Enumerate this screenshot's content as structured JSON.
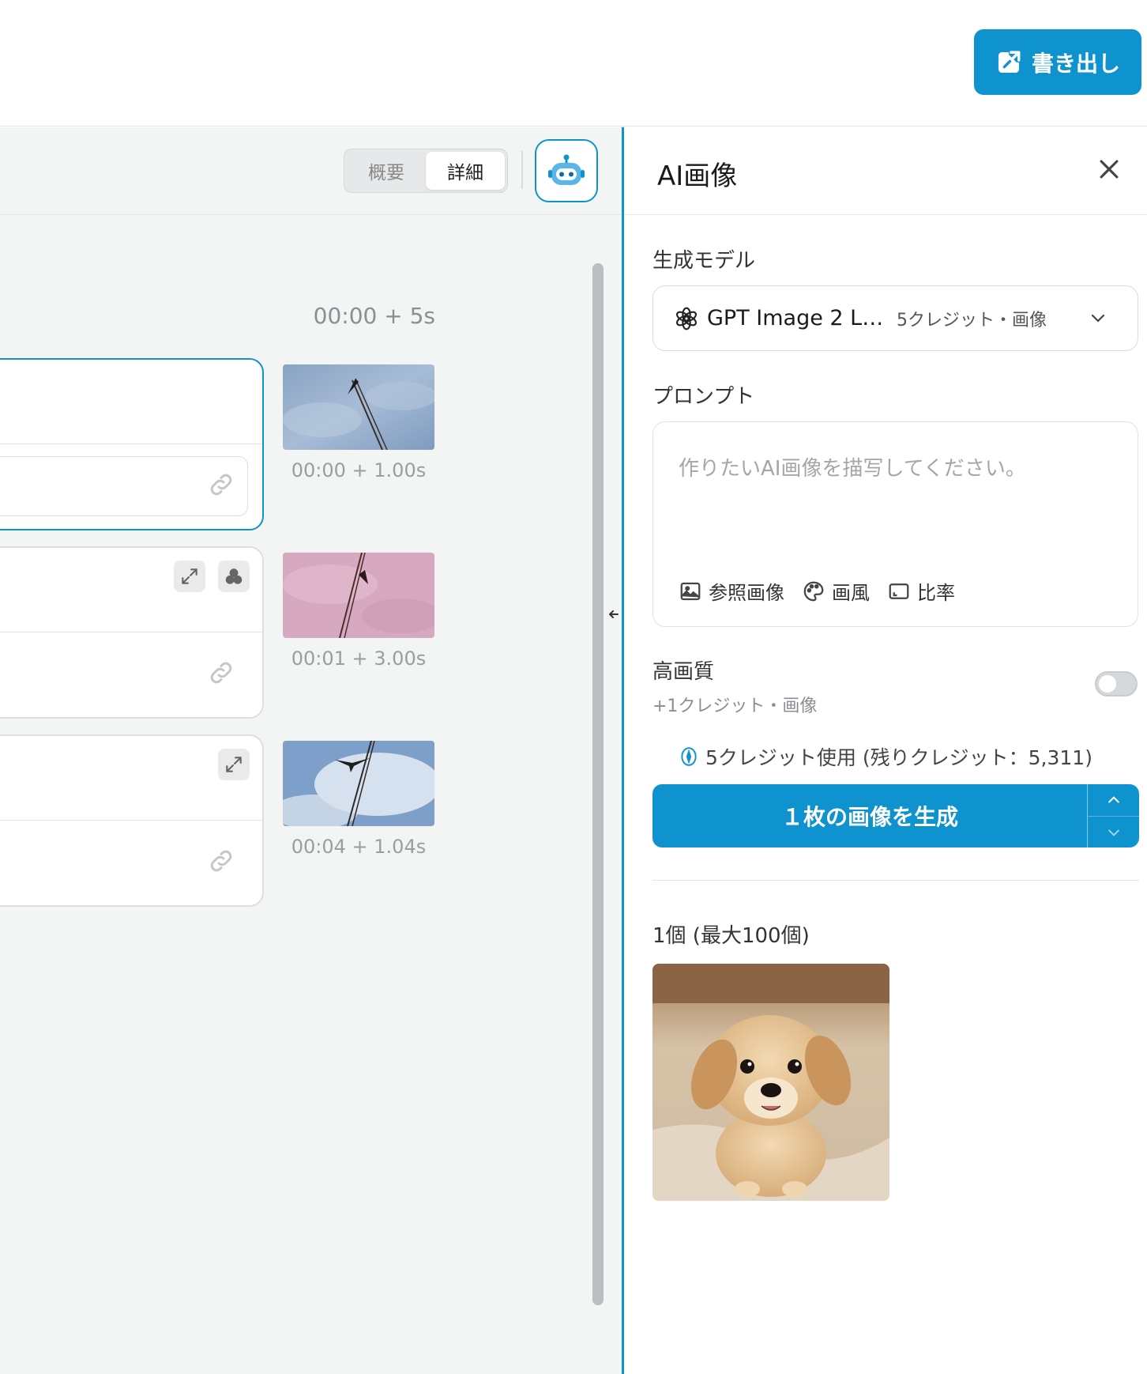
{
  "topbar": {
    "export_label": "書き出し"
  },
  "view_toggle": {
    "summary": "概要",
    "detail": "詳細"
  },
  "timeline": {
    "total_time": "00:00 + 5s",
    "scenes": [
      {
        "time": "00:00 + 1.00s",
        "active": true
      },
      {
        "time": "00:01 + 3.00s",
        "active": false
      },
      {
        "time": "00:04 + 1.04s",
        "active": false
      }
    ]
  },
  "panel": {
    "title": "AI画像",
    "model_label": "生成モデル",
    "model_name": "GPT Image 2 L…",
    "model_cost": "5クレジット・画像",
    "prompt_label": "プロンプト",
    "prompt_placeholder": "作りたいAI画像を描写してください。",
    "tools": {
      "reference": "参照画像",
      "style": "画風",
      "ratio": "比率"
    },
    "hq_label": "高画質",
    "hq_sub": "+1クレジット・画像",
    "hq_enabled": false,
    "credit_usage": "5クレジット使用 (残りクレジット：5,311)",
    "generate_label": "１枚の画像を生成",
    "count_label": "1個 (最大100個)"
  },
  "colors": {
    "accent": "#0e93cf"
  }
}
